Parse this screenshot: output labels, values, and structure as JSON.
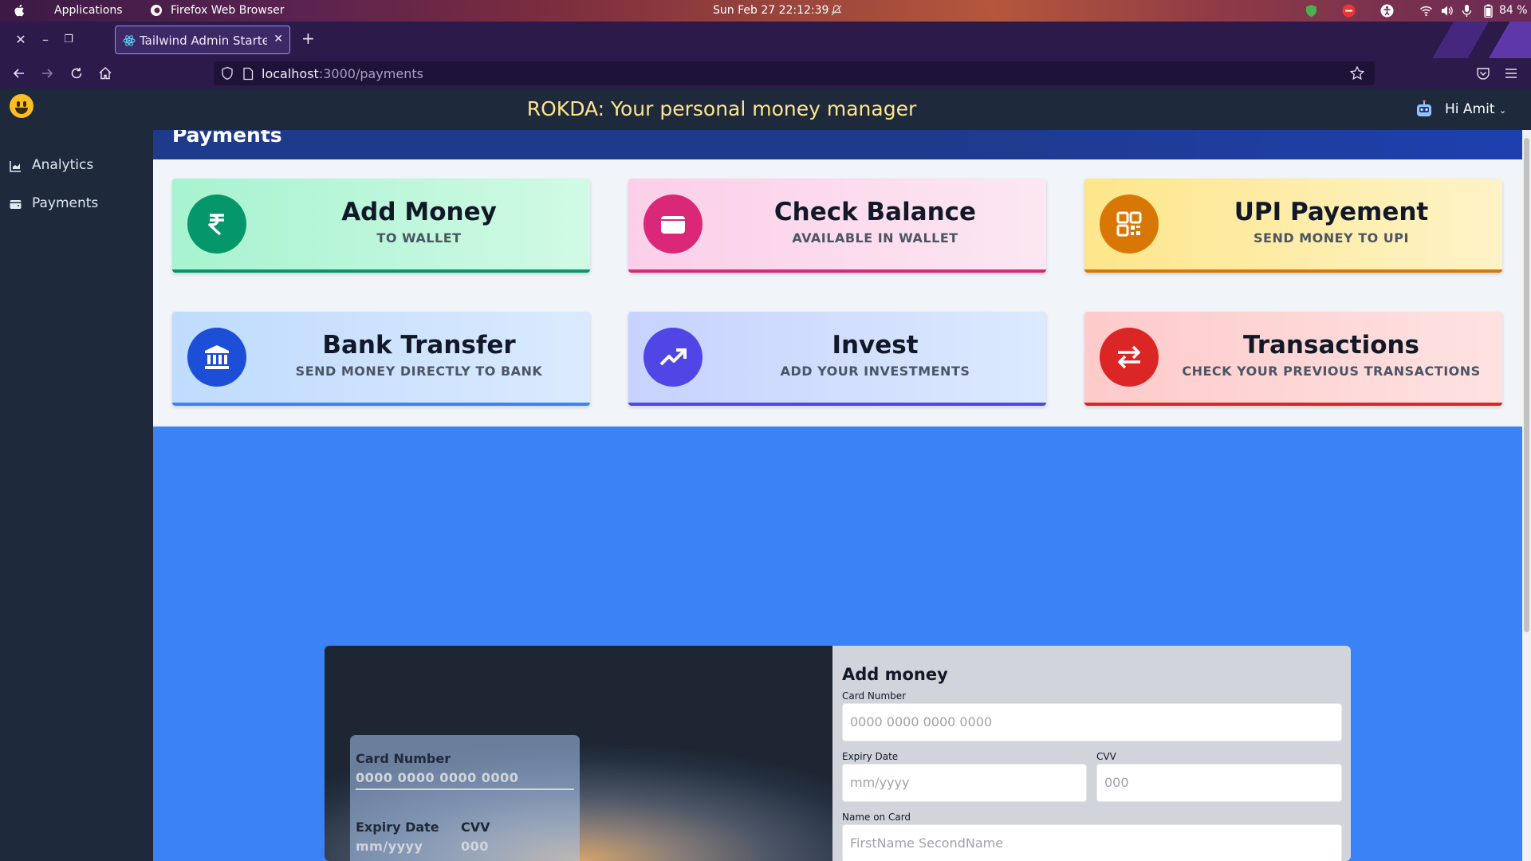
{
  "system_bar": {
    "applications_label": "Applications",
    "active_app_label": "Firefox Web Browser",
    "clock": "Sun Feb 27  22:12:39",
    "battery": "84 %"
  },
  "browser": {
    "tab_title": "Tailwind Admin Starter",
    "url_host": "localhost",
    "url_path": ":3000/payments"
  },
  "app": {
    "title": "ROKDA: Your personal money manager",
    "user_greeting": "Hi Amit",
    "sidebar": {
      "items": [
        {
          "label": "Analytics",
          "icon": "chart-icon"
        },
        {
          "label": "Payments",
          "icon": "wallet-icon"
        }
      ]
    },
    "page_title": "Payments",
    "tiles": [
      {
        "title": "Add Money",
        "subtitle": "TO WALLET",
        "icon": "rupee-icon",
        "bg": "#a7f3d0",
        "accent": "#059669"
      },
      {
        "title": "Check Balance",
        "subtitle": "AVAILABLE IN WALLET",
        "icon": "wallet-icon",
        "bg": "#fbcfe8",
        "accent": "#db2777"
      },
      {
        "title": "UPI Payement",
        "subtitle": "SEND MONEY TO UPI",
        "icon": "qr-code-icon",
        "bg": "#fde68a",
        "accent": "#d97706"
      },
      {
        "title": "Bank Transfer",
        "subtitle": "SEND MONEY DIRECTLY TO BANK",
        "icon": "bank-icon",
        "bg": "#bfdbfe",
        "accent": "#1d4ed8"
      },
      {
        "title": "Invest",
        "subtitle": "ADD YOUR INVESTMENTS",
        "icon": "trending-up-icon",
        "bg": "#c7d2fe",
        "accent": "#4f46e5"
      },
      {
        "title": "Transactions",
        "subtitle": "CHECK YOUR PREVIOUS TRANSACTIONS",
        "icon": "exchange-icon",
        "bg": "#fecaca",
        "accent": "#dc2626"
      }
    ],
    "card_preview": {
      "number_label": "Card Number",
      "number_value": "0000 0000 0000 0000",
      "expiry_label": "Expiry Date",
      "expiry_value": "mm/yyyy",
      "cvv_label": "CVV",
      "cvv_value": "000"
    },
    "add_money_form": {
      "title": "Add money",
      "card_number_label": "Card Number",
      "card_number_placeholder": "0000 0000 0000 0000",
      "expiry_label": "Expiry Date",
      "expiry_placeholder": "mm/yyyy",
      "cvv_label": "CVV",
      "cvv_placeholder": "000",
      "name_label": "Name on Card",
      "name_placeholder": "FirstName SecondName"
    }
  }
}
